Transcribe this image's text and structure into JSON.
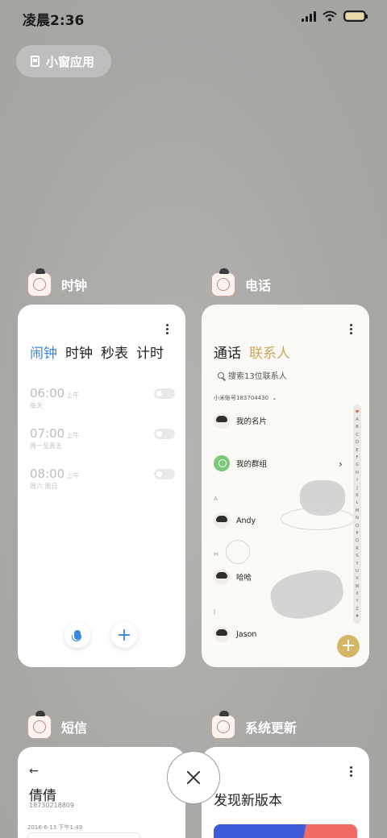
{
  "status_bar": {
    "time": "凌晨2:36"
  },
  "floating_window": {
    "label": "小窗应用"
  },
  "apps": {
    "clock": {
      "name": "时钟",
      "tabs": [
        "闹钟",
        "时钟",
        "秒表",
        "计时"
      ],
      "active_tab": 0,
      "alarms": [
        {
          "time": "06:00",
          "ampm": "上午",
          "repeat": "每天",
          "enabled": false
        },
        {
          "time": "07:00",
          "ampm": "上午",
          "repeat": "周一至周五",
          "enabled": false
        },
        {
          "time": "08:00",
          "ampm": "上午",
          "repeat": "周六 周日",
          "enabled": false
        }
      ],
      "add_symbol": "+"
    },
    "phone": {
      "name": "电话",
      "tabs": [
        "通话",
        "联系人"
      ],
      "search_placeholder": "搜索13位联系人",
      "account": "小米账号183704430",
      "contacts": {
        "my_card": "我的名片",
        "my_groups": "我的群组",
        "andy": "Andy",
        "haha": "哈哈",
        "jason": "Jason"
      },
      "section_letters": {
        "a": "A",
        "h": "H",
        "j": "J"
      },
      "alpha_index": [
        "A",
        "B",
        "C",
        "D",
        "E",
        "F",
        "G",
        "H",
        "I",
        "J",
        "K",
        "L",
        "M",
        "N",
        "O",
        "P",
        "Q",
        "R",
        "S",
        "T",
        "U",
        "V",
        "W",
        "X",
        "Y",
        "Z",
        "#"
      ],
      "fab_symbol": "+"
    },
    "messages": {
      "name": "短信",
      "back_symbol": "←",
      "contact_name": "倩倩",
      "contact_number": "18730218809",
      "date": "2016-6-13 下午1:49"
    },
    "system_update": {
      "name": "系统更新",
      "title": "发现新版本"
    }
  },
  "colors": {
    "accent_blue": "#3a86e0",
    "accent_gold": "#c9a760",
    "fab_gold": "#d4b766"
  }
}
